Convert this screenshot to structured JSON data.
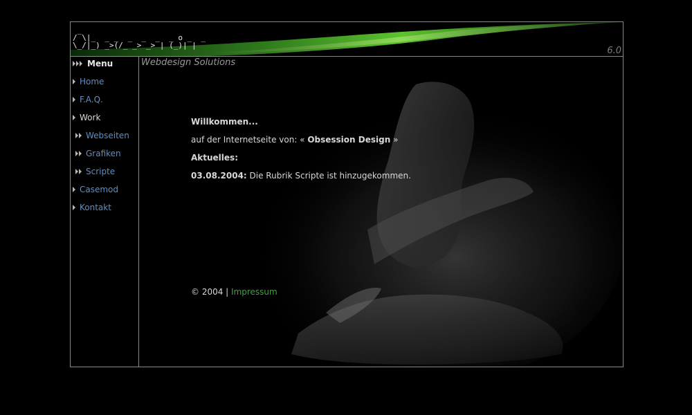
{
  "header": {
    "logo_text": " _\n/ \\|_  _ _  _  _  _  _ o _  _\n\\_/|_) _>(/_ _> _> | (_)| |",
    "version": "6.0",
    "tagline": "Webdesign Solutions"
  },
  "menu": {
    "title": "Menu",
    "items": [
      {
        "label": "Home"
      },
      {
        "label": "F.A.Q."
      },
      {
        "label": "Work"
      },
      {
        "label": "Webseiten"
      },
      {
        "label": "Grafiken"
      },
      {
        "label": "Scripte"
      },
      {
        "label": "Casemod"
      },
      {
        "label": "Kontakt"
      }
    ]
  },
  "content": {
    "welcome": "Willkommen...",
    "intro_prefix": "auf der Internetseite von: « ",
    "intro_name": "Obsession Design",
    "intro_suffix": " »",
    "news_heading": "Aktuelles:",
    "news_date": "03.08.2004:",
    "news_text": " Die Rubrik Scripte ist hinzugekommen.",
    "footer_copyright": "© 2004 | ",
    "footer_link": "Impressum"
  },
  "colors": {
    "accent_green": "#3ea53e",
    "link_blue": "#5f8fc3",
    "border": "#8a8a8a"
  }
}
